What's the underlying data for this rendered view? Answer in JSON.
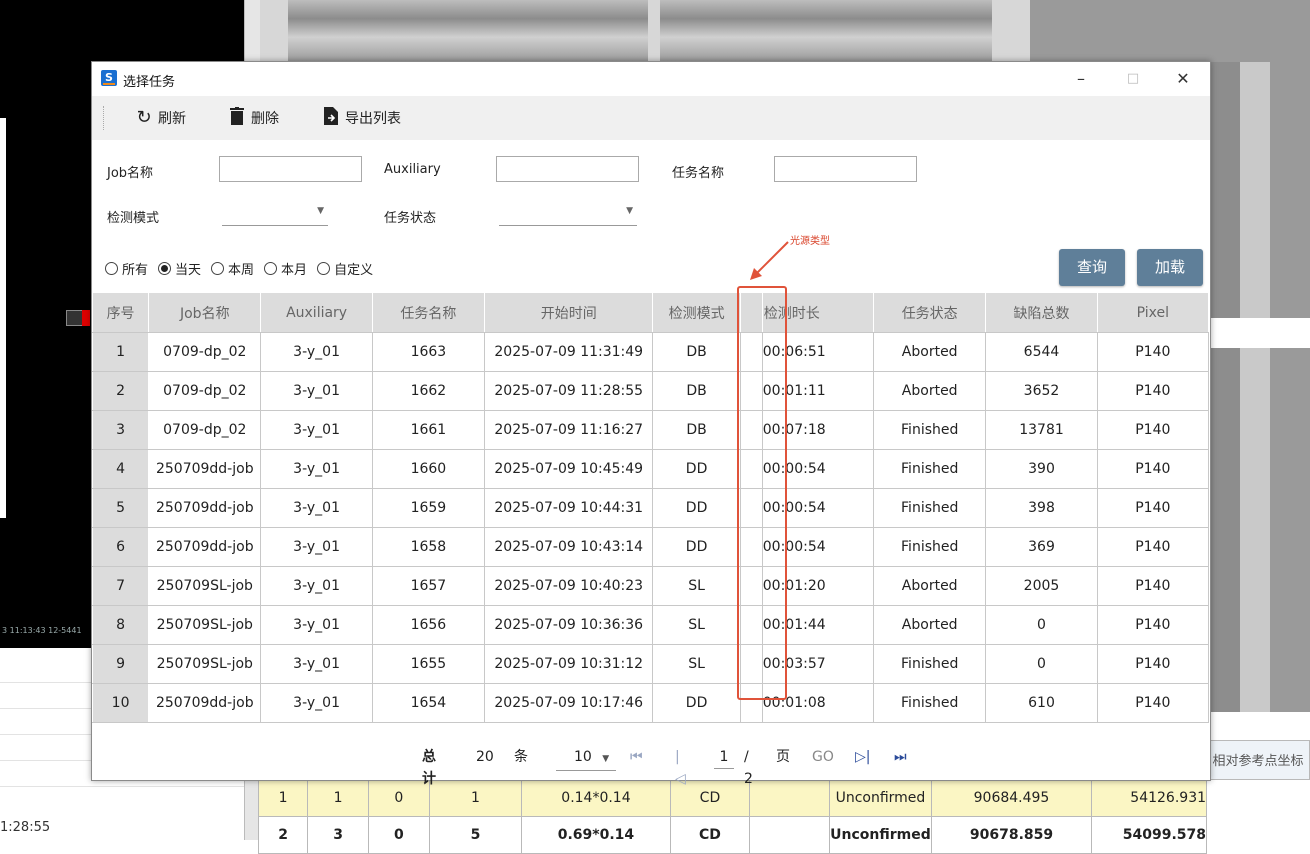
{
  "dialog": {
    "title": "选择任务",
    "icon_letter": "S",
    "window_controls": {
      "minimize": "–",
      "maximize": "□",
      "close": "✕"
    }
  },
  "toolbar": {
    "refresh": {
      "icon": "refresh-icon",
      "label": "刷新"
    },
    "delete": {
      "icon": "trash-icon",
      "label": "删除"
    },
    "export": {
      "icon": "export-icon",
      "label": "导出列表"
    }
  },
  "filters": {
    "job_name_label": "Job名称",
    "auxiliary_label": "Auxiliary",
    "task_name_label": "任务名称",
    "detect_mode_label": "检测模式",
    "task_status_label": "任务状态",
    "job_name_value": "",
    "auxiliary_value": "",
    "task_name_value": "",
    "detect_mode_value": "",
    "task_status_value": ""
  },
  "range": {
    "options": [
      {
        "label": "所有",
        "selected": false
      },
      {
        "label": "当天",
        "selected": true
      },
      {
        "label": "本周",
        "selected": false
      },
      {
        "label": "本月",
        "selected": false
      },
      {
        "label": "自定义",
        "selected": false
      }
    ]
  },
  "actions": {
    "query": "查询",
    "load": "加载"
  },
  "table": {
    "headers": [
      "序号",
      "Job名称",
      "Auxiliary",
      "任务名称",
      "开始时间",
      "检测模式",
      "",
      "检测时长",
      "任务状态",
      "缺陷总数",
      "Pixel"
    ],
    "rows": [
      [
        "1",
        "0709-dp_02",
        "3-y_01",
        "1663",
        "2025-07-09 11:31:49",
        "DB",
        "",
        "00:06:51",
        "Aborted",
        "6544",
        "P140"
      ],
      [
        "2",
        "0709-dp_02",
        "3-y_01",
        "1662",
        "2025-07-09 11:28:55",
        "DB",
        "",
        "00:01:11",
        "Aborted",
        "3652",
        "P140"
      ],
      [
        "3",
        "0709-dp_02",
        "3-y_01",
        "1661",
        "2025-07-09 11:16:27",
        "DB",
        "",
        "00:07:18",
        "Finished",
        "13781",
        "P140"
      ],
      [
        "4",
        "250709dd-job",
        "3-y_01",
        "1660",
        "2025-07-09 10:45:49",
        "DD",
        "",
        "00:00:54",
        "Finished",
        "390",
        "P140"
      ],
      [
        "5",
        "250709dd-job",
        "3-y_01",
        "1659",
        "2025-07-09 10:44:31",
        "DD",
        "",
        "00:00:54",
        "Finished",
        "398",
        "P140"
      ],
      [
        "6",
        "250709dd-job",
        "3-y_01",
        "1658",
        "2025-07-09 10:43:14",
        "DD",
        "",
        "00:00:54",
        "Finished",
        "369",
        "P140"
      ],
      [
        "7",
        "250709SL-job",
        "3-y_01",
        "1657",
        "2025-07-09 10:40:23",
        "SL",
        "",
        "00:01:20",
        "Aborted",
        "2005",
        "P140"
      ],
      [
        "8",
        "250709SL-job",
        "3-y_01",
        "1656",
        "2025-07-09 10:36:36",
        "SL",
        "",
        "00:01:44",
        "Aborted",
        "0",
        "P140"
      ],
      [
        "9",
        "250709SL-job",
        "3-y_01",
        "1655",
        "2025-07-09 10:31:12",
        "SL",
        "",
        "00:03:57",
        "Finished",
        "0",
        "P140"
      ],
      [
        "10",
        "250709dd-job",
        "3-y_01",
        "1654",
        "2025-07-09 10:17:46",
        "DD",
        "",
        "00:01:08",
        "Finished",
        "610",
        "P140"
      ]
    ]
  },
  "pager": {
    "total_label": "总计",
    "total": "20",
    "unit": "条",
    "page_size": "10",
    "first": "⏮",
    "prev": "|◁",
    "current_page": "1",
    "total_pages": "/ 2",
    "page_unit": "页",
    "go": "GO",
    "next": "▷|",
    "last": "⏭"
  },
  "annotation": {
    "text": "光源类型",
    "color": "#e0533a"
  },
  "background": {
    "clock": "1:28:55",
    "small_text": "3 11:13:43        12-5441",
    "table_header": "相对参考点坐标",
    "rows": [
      [
        "1",
        "1",
        "0",
        "1",
        "0.14*0.14",
        "CD",
        "",
        "Unconfirmed",
        "90684.495",
        "54126.931"
      ],
      [
        "2",
        "3",
        "0",
        "5",
        "0.69*0.14",
        "CD",
        "",
        "Unconfirmed",
        "90678.859",
        "54099.578"
      ]
    ]
  },
  "colors": {
    "accent_button": "#5f7f99",
    "header_bg": "#dcdcdc",
    "highlight_row": "#fbf6c4",
    "annotation": "#e0533a"
  }
}
